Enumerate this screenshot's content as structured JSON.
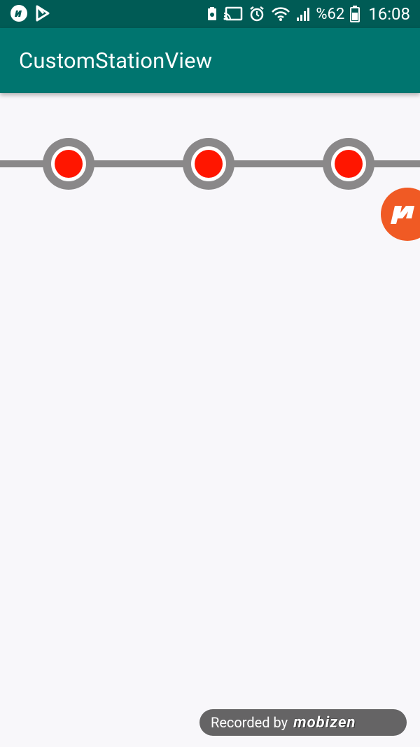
{
  "status_bar": {
    "left_icons": [
      "mobizen-icon",
      "play-store-icon"
    ],
    "right_icons": [
      "battery-saver-icon",
      "cast-icon",
      "alarm-icon",
      "wifi-icon",
      "signal-icon",
      "battery-icon"
    ],
    "battery_percent": "%62",
    "time": "16:08"
  },
  "app_bar": {
    "title": "CustomStationView",
    "color": "#00756f"
  },
  "station_view": {
    "station_count": 3,
    "line_color": "#8a8889",
    "dot_color": "#ff1600"
  },
  "recorder": {
    "label": "Recorded by",
    "brand": "mobizen"
  }
}
